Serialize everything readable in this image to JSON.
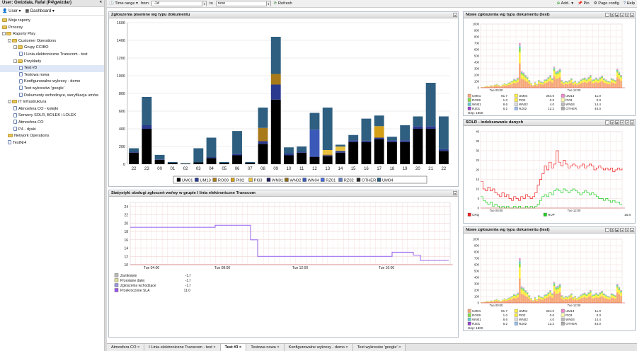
{
  "user": {
    "title": "User: Gwizdała, Rafał (P4\\gwizdar)",
    "user_label": "User",
    "dashboard_label": "Dashboard"
  },
  "tree": [
    {
      "label": "Moje raporty",
      "indent": 0,
      "type": "folder",
      "exp": ""
    },
    {
      "label": "Procesy",
      "indent": 0,
      "type": "folder",
      "exp": ""
    },
    {
      "label": "Raporty Play",
      "indent": 0,
      "type": "folder",
      "exp": "-"
    },
    {
      "label": "Customer Operations",
      "indent": 1,
      "type": "folder",
      "exp": "-"
    },
    {
      "label": "Grupy CC/BO",
      "indent": 2,
      "type": "folder",
      "exp": "-"
    },
    {
      "label": "I Linia elektroniczne Transcom - test",
      "indent": 3,
      "type": "page",
      "exp": ""
    },
    {
      "label": "Przykłady",
      "indent": 2,
      "type": "folder",
      "exp": "-"
    },
    {
      "label": "Test #3",
      "indent": 3,
      "type": "page",
      "exp": "",
      "sel": true
    },
    {
      "label": "Testowa nowa",
      "indent": 3,
      "type": "page",
      "exp": ""
    },
    {
      "label": "Konfigurowalne wykresy - demo",
      "indent": 3,
      "type": "page",
      "exp": ""
    },
    {
      "label": "Test wykresów 'google'",
      "indent": 3,
      "type": "page",
      "exp": ""
    },
    {
      "label": "Dokumenty wchodzące, weryfikacja umów",
      "indent": 3,
      "type": "page",
      "exp": ""
    },
    {
      "label": "IT Infrastruktura",
      "indent": 1,
      "type": "folder",
      "exp": "-"
    },
    {
      "label": "Atmosfera CO - kolejki",
      "indent": 2,
      "type": "page",
      "exp": ""
    },
    {
      "label": "Serwery SOLR, BOLEK i LOLEK",
      "indent": 2,
      "type": "page",
      "exp": ""
    },
    {
      "label": "Atmosfera CO",
      "indent": 2,
      "type": "page",
      "exp": ""
    },
    {
      "label": "P4 - dyski",
      "indent": 2,
      "type": "page",
      "exp": ""
    },
    {
      "label": "Network Operations",
      "indent": 1,
      "type": "folder",
      "exp": ""
    },
    {
      "label": "TestNr4",
      "indent": 1,
      "type": "page",
      "exp": ""
    }
  ],
  "toolbar": {
    "time_range": "Time range",
    "from_label": "from",
    "from_value": "-1d",
    "to_label": "to",
    "to_value": "now",
    "refresh": "Refresh",
    "add": "Add..",
    "pin": "Pin",
    "page_config": "Page config",
    "help": "Help"
  },
  "panels": {
    "main": "Zgłoszenia pisemne wg typu dokumentu",
    "sla": "Statystyki obsługi zgłoszeń we/wy w grupie I linia elektroniczne Transcom",
    "new1": "Nowe zgłoszenia wg typu dokumentu (test)",
    "solr": "SOLR - indeksowanie danych",
    "new2": "Nowe zgłoszenia wg typu dokumentu (test)"
  },
  "chart_data": [
    {
      "type": "bar",
      "stacked": true,
      "categories": [
        "22",
        "23",
        "00",
        "01",
        "02",
        "03",
        "04",
        "05",
        "06",
        "07",
        "08",
        "09",
        "10",
        "11",
        "12",
        "13",
        "14",
        "15",
        "16",
        "17",
        "18",
        "19",
        "20",
        "21",
        "22"
      ],
      "ylim": [
        0,
        1600
      ],
      "yticks": [
        0,
        200,
        400,
        600,
        800,
        1000,
        1200,
        1400,
        1600
      ],
      "series": [
        {
          "name": "UM01",
          "color": "#000000",
          "values": [
            130,
            400,
            50,
            15,
            5,
            20,
            70,
            15,
            100,
            15,
            230,
            730,
            100,
            130,
            80,
            90,
            130,
            250,
            250,
            280,
            250,
            250,
            400,
            400,
            150
          ]
        },
        {
          "name": "UM13",
          "color": "#2b3a8f",
          "values": [
            10,
            40,
            5,
            0,
            0,
            0,
            10,
            0,
            15,
            0,
            30,
            170,
            20,
            10,
            10,
            10,
            20,
            20,
            15,
            20,
            20,
            20,
            30,
            30,
            20
          ]
        },
        {
          "name": "RO09",
          "color": "#a87a1a",
          "values": [
            0,
            0,
            0,
            0,
            0,
            0,
            0,
            0,
            0,
            0,
            150,
            120,
            0,
            0,
            0,
            10,
            0,
            0,
            0,
            0,
            0,
            0,
            0,
            0,
            0
          ]
        },
        {
          "name": "PI02",
          "color": "#d4a017",
          "values": [
            0,
            0,
            0,
            0,
            0,
            0,
            0,
            0,
            0,
            0,
            0,
            0,
            0,
            0,
            0,
            0,
            0,
            0,
            0,
            130,
            0,
            0,
            0,
            0,
            0
          ]
        },
        {
          "name": "PI03",
          "color": "#e8c040",
          "values": [
            0,
            0,
            0,
            0,
            0,
            0,
            0,
            0,
            0,
            0,
            0,
            0,
            0,
            0,
            0,
            50,
            50,
            0,
            0,
            0,
            0,
            0,
            0,
            0,
            0
          ]
        },
        {
          "name": "WN01",
          "color": "#1f1f5f",
          "values": [
            0,
            0,
            0,
            0,
            0,
            0,
            0,
            0,
            0,
            0,
            0,
            0,
            0,
            0,
            0,
            0,
            0,
            0,
            0,
            0,
            0,
            0,
            0,
            0,
            0
          ]
        },
        {
          "name": "WN02",
          "color": "#8b6b1a",
          "values": [
            0,
            0,
            0,
            0,
            0,
            0,
            0,
            0,
            0,
            0,
            0,
            0,
            0,
            0,
            0,
            0,
            0,
            0,
            0,
            0,
            0,
            0,
            0,
            0,
            0
          ]
        },
        {
          "name": "WN04",
          "color": "#3b59b8",
          "values": [
            0,
            0,
            0,
            0,
            0,
            0,
            0,
            0,
            0,
            0,
            0,
            0,
            0,
            0,
            300,
            0,
            0,
            0,
            0,
            0,
            0,
            0,
            0,
            0,
            0
          ]
        },
        {
          "name": "RZ01",
          "color": "#4a68d8",
          "values": [
            0,
            0,
            0,
            0,
            0,
            0,
            0,
            0,
            0,
            0,
            0,
            0,
            0,
            0,
            0,
            0,
            0,
            0,
            0,
            0,
            0,
            0,
            0,
            0,
            0
          ]
        },
        {
          "name": "RZ02",
          "color": "#5d7ab8",
          "values": [
            0,
            0,
            0,
            0,
            0,
            0,
            0,
            0,
            0,
            0,
            0,
            0,
            0,
            0,
            0,
            0,
            0,
            0,
            0,
            0,
            0,
            0,
            0,
            0,
            0
          ]
        },
        {
          "name": "OTHER",
          "color": "#2c2c2c",
          "values": [
            0,
            0,
            0,
            0,
            0,
            0,
            0,
            0,
            0,
            0,
            0,
            0,
            0,
            0,
            0,
            0,
            0,
            0,
            0,
            0,
            0,
            0,
            0,
            0,
            0
          ]
        },
        {
          "name": "UM04",
          "color": "#2e5f80",
          "values": [
            40,
            320,
            50,
            10,
            5,
            160,
            220,
            10,
            260,
            10,
            230,
            420,
            70,
            60,
            190,
            480,
            20,
            60,
            250,
            120,
            40,
            170,
            110,
            490,
            370
          ]
        }
      ]
    },
    {
      "type": "line",
      "xticks": [
        "Tue 04:00",
        "Tue 08:00",
        "Tue 12:00",
        "Tue 16:00"
      ],
      "ylim": [
        10,
        25
      ],
      "yticks": [
        10,
        12,
        14,
        16,
        18,
        20,
        22,
        24
      ],
      "legend": [
        {
          "name": "Zamknięte",
          "value": "-1.f",
          "color": "#bbbbbb"
        },
        {
          "name": "Przesłane dalej",
          "value": "-1.f",
          "color": "#dddd99"
        },
        {
          "name": "Zgłoszenia wchodzące",
          "value": "-1.f",
          "color": "#9999dd"
        },
        {
          "name": "Przekroczone SLA",
          "value": "11.0",
          "color": "#9955ee"
        }
      ]
    },
    {
      "type": "bar",
      "xticks": [
        "Tue 00:00",
        "Tue 12:00"
      ],
      "yticks": [
        0,
        100,
        200,
        300,
        400,
        500,
        600,
        700,
        800,
        900,
        1000
      ],
      "legend": [
        {
          "name": "UM01",
          "value": "91.7",
          "color": "#f5a87a"
        },
        {
          "name": "UM04",
          "value": "264.0",
          "color": "#ffee44"
        },
        {
          "name": "UM13",
          "value": "11.0",
          "color": "#ee88cc"
        },
        {
          "name": "RO09",
          "value": "1.0",
          "color": "#88dd44"
        },
        {
          "name": "PI02",
          "value": "0.0",
          "color": "#ffee44"
        },
        {
          "name": "PI03",
          "value": "0.0",
          "color": "#ffffaa"
        },
        {
          "name": "WN01",
          "value": "8.6",
          "color": "#66cccc"
        },
        {
          "name": "WN02",
          "value": "4.0",
          "color": "#dddddd"
        },
        {
          "name": "WN04",
          "value": "14.4",
          "color": "#bbbbbb"
        },
        {
          "name": "RZ01",
          "value": "6.2",
          "color": "#9944cc"
        },
        {
          "name": "RZ02",
          "value": "12.2",
          "color": "#99bbee"
        },
        {
          "name": "OTHER",
          "value": "45.0",
          "color": "#aaaaaa"
        }
      ],
      "step": "step: 1800"
    },
    {
      "type": "line",
      "xticks": [
        "Tue 00:00",
        "Tue 12:00"
      ],
      "yticks": [
        0,
        5,
        10,
        15,
        20,
        25,
        30,
        35,
        40
      ],
      "legend": [
        {
          "name": "CRQ",
          "color": "#ee2222"
        },
        {
          "name": "HUP",
          "value": "15.8",
          "color": "#22cc22"
        }
      ]
    }
  ]
}
